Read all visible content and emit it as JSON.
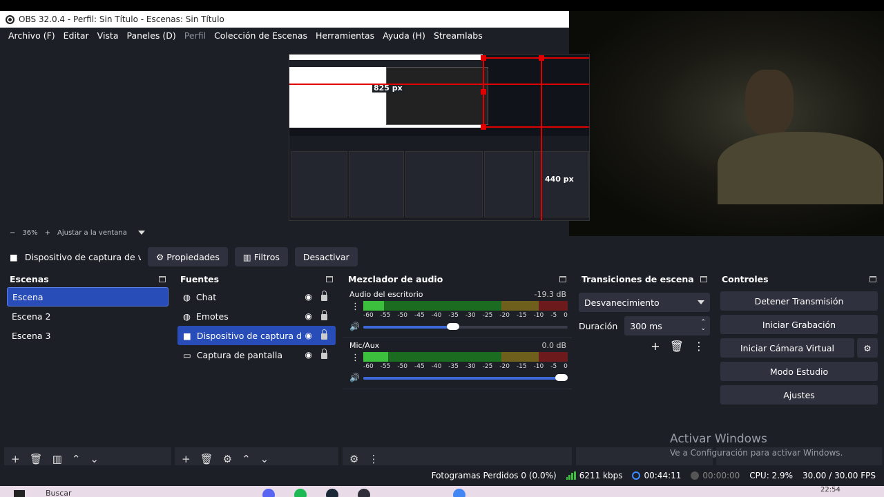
{
  "window": {
    "title": "OBS 32.0.4 - Perfil: Sin Título - Escenas: Sin Título"
  },
  "menu": [
    "Archivo (F)",
    "Editar",
    "Vista",
    "Paneles (D)",
    "Perfil",
    "Colección de Escenas",
    "Herramientas",
    "Ayuda (H)",
    "Streamlabs"
  ],
  "preview": {
    "px_label_top": "825 px",
    "px_label_side": "440 px",
    "zoom": "36%",
    "fit_label": "Ajustar a la ventana"
  },
  "source_toolbar": {
    "current": "Dispositivo de captura de v",
    "properties": "Propiedades",
    "filters": "Filtros",
    "deactivate": "Desactivar"
  },
  "scenes": {
    "title": "Escenas",
    "items": [
      "Escena",
      "Escena 2",
      "Escena 3"
    ]
  },
  "sources": {
    "title": "Fuentes",
    "items": [
      "Chat",
      "Emotes",
      "Dispositivo de captura de v",
      "Captura de pantalla"
    ]
  },
  "mixer": {
    "title": "Mezclador de audio",
    "ticks": [
      "-60",
      "-55",
      "-50",
      "-45",
      "-40",
      "-35",
      "-30",
      "-25",
      "-20",
      "-15",
      "-10",
      "-5",
      "0"
    ],
    "channels": [
      {
        "name": "Audio del escritorio",
        "db": "-19.3 dB",
        "level": 0.1,
        "volume": 0.47
      },
      {
        "name": "Mic/Aux",
        "db": "0.0 dB",
        "level": 0.12,
        "volume": 1.0
      }
    ]
  },
  "transitions": {
    "title": "Transiciones de escena",
    "selected": "Desvanecimiento",
    "duration_label": "Duración",
    "duration_value": "300 ms"
  },
  "controls": {
    "title": "Controles",
    "stop_stream": "Detener Transmisión",
    "start_record": "Iniciar Grabación",
    "virtual_cam": "Iniciar Cámara Virtual",
    "studio_mode": "Modo Estudio",
    "settings": "Ajustes"
  },
  "status": {
    "dropped": "Fotogramas Perdidos 0 (0.0%)",
    "bitrate": "6211 kbps",
    "stream_time": "00:44:11",
    "record_time": "00:00:00",
    "cpu": "CPU: 2.9%",
    "fps": "30.00 / 30.00 FPS"
  },
  "watermark": {
    "line1": "Activar Windows",
    "line2": "Ve a Configuración para activar Windows."
  },
  "taskbar": {
    "search": "Buscar",
    "clock": "22:54"
  }
}
